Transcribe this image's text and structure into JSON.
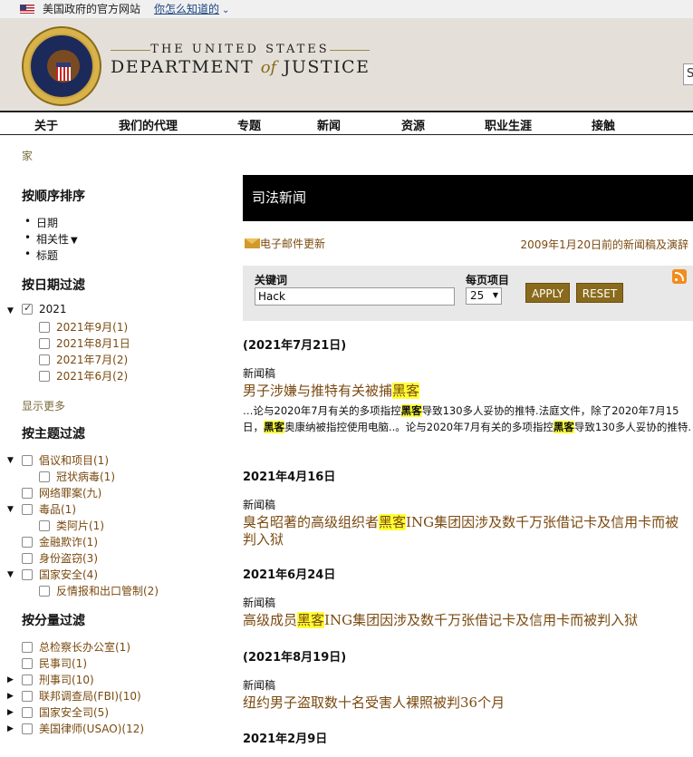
{
  "gov_banner": {
    "text": "美国政府的官方网站",
    "link": "你怎么知道的"
  },
  "header": {
    "top_line": "THE UNITED STATES",
    "main_left": "DEPARTMENT",
    "main_of": "of",
    "main_right": "JUSTICE",
    "search_stub": "S"
  },
  "nav": [
    "关于",
    "我们的代理",
    "专题",
    "新闻",
    "资源",
    "职业生涯",
    "接触"
  ],
  "breadcrumb": "家",
  "sidebar": {
    "sort_title": "按顺序排序",
    "sort_items": [
      "日期",
      "相关性",
      "标题"
    ],
    "date_title": "按日期过滤",
    "date_year": "2021",
    "date_months": [
      "2021年9月(1)",
      "2021年8月1日",
      "2021年7月(2)",
      "2021年6月(2)"
    ],
    "show_more": "显示更多",
    "topic_title": "按主题过滤",
    "topics": [
      "倡议和项目(1)",
      "冠状病毒(1)",
      "网络罪案(九)",
      "毒品(1)",
      "类阿片(1)",
      "金融欺诈(1)",
      "身份盗窃(3)",
      "国家安全(4)",
      "反情报和出口管制(2)"
    ],
    "component_title": "按分量过滤",
    "components": [
      "总检察长办公室(1)",
      "民事司(1)",
      "刑事司(10)",
      "联邦调查局(FBI)(10)",
      "国家安全司(5)",
      "美国律师(USAO)(12)"
    ]
  },
  "content": {
    "title": "司法新闻",
    "email_updates": "电子邮件更新",
    "archive_link": "2009年1月20日前的新闻稿及演辞",
    "keyword_label": "关键词",
    "keyword_value": "Hack",
    "per_page_label": "每页项目",
    "per_page_value": "25",
    "apply": "APPLY",
    "reset": "RESET"
  },
  "results": [
    {
      "date": "(2021年7月21日)",
      "type": "新闻稿",
      "title_pre": "男子涉嫌与推特有关被捕",
      "title_hl": "黑客",
      "title_post": "",
      "snippet": {
        "s1": "…论与2020年7月有关的多项指控",
        "h1": "黑客",
        "s2": "导致130多人妥协的推特.法庭文件，除了2020年7月15日，",
        "h2": "黑客",
        "s3": "奥康纳被指控使用电脑..。论与2020年7月有关的多项指控",
        "h3": "黑客",
        "s4": "导致130多人妥协的推特."
      }
    },
    {
      "date": "2021年4月16日",
      "type": "新闻稿",
      "title_pre": "臭名昭著的高级组织者",
      "title_hl": "黑客",
      "title_post": "ING集团因涉及数千万张借记卡及信用卡而被判入狱"
    },
    {
      "date": "2021年6月24日",
      "type": "新闻稿",
      "title_pre": "高级成员",
      "title_hl": "黑客",
      "title_post": "ING集团因涉及数千万张借记卡及信用卡而被判入狱"
    },
    {
      "date": "(2021年8月19日)",
      "type": "新闻稿",
      "title_pre": "纽约男子盗取数十名受害人裸照被判36个月",
      "title_hl": "",
      "title_post": ""
    },
    {
      "date": "2021年2月9日"
    }
  ]
}
